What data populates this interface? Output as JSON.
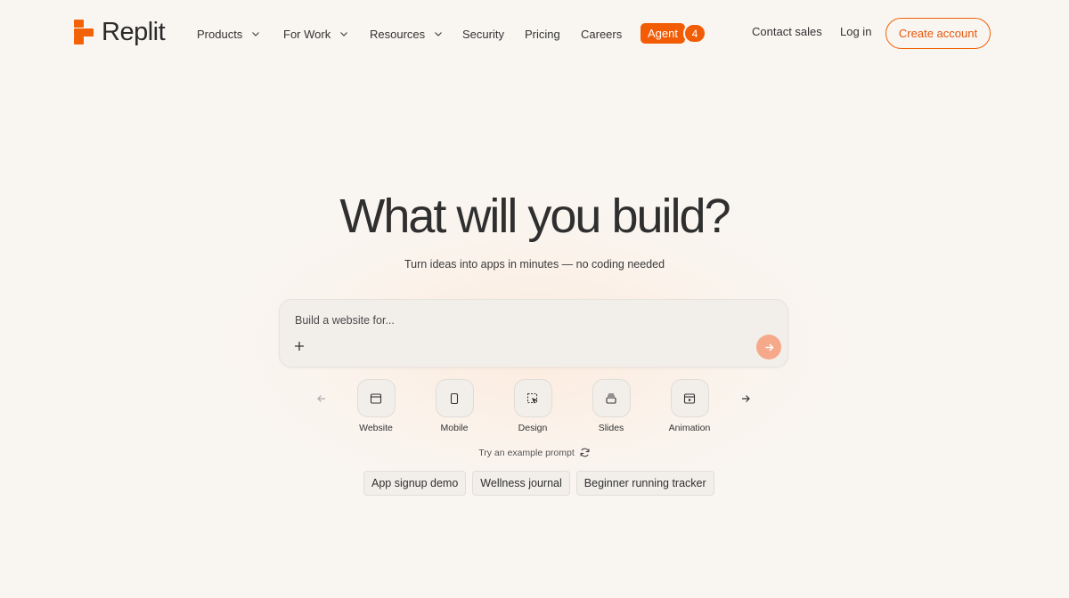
{
  "brand": {
    "name": "Replit",
    "accent": "#f26207"
  },
  "nav": {
    "items": [
      {
        "label": "Products",
        "has_dropdown": true
      },
      {
        "label": "For Work",
        "has_dropdown": true
      },
      {
        "label": "Resources",
        "has_dropdown": true
      },
      {
        "label": "Security",
        "has_dropdown": false
      },
      {
        "label": "Pricing",
        "has_dropdown": false
      },
      {
        "label": "Careers",
        "has_dropdown": false
      }
    ],
    "agent": {
      "label": "Agent",
      "badge": "4"
    },
    "contact_sales": "Contact sales",
    "log_in": "Log in",
    "create_account": "Create account"
  },
  "hero": {
    "title": "What will you build?",
    "subtitle": "Turn ideas into apps in minutes — no coding needed"
  },
  "prompt": {
    "placeholder": "Build a website for...",
    "value": "",
    "add_icon": "plus-icon",
    "send_icon": "arrow-right-icon"
  },
  "categories": [
    {
      "label": "Website",
      "icon": "browser-window-icon"
    },
    {
      "label": "Mobile",
      "icon": "phone-icon"
    },
    {
      "label": "Design",
      "icon": "design-cursor-icon"
    },
    {
      "label": "Slides",
      "icon": "slides-stack-icon"
    },
    {
      "label": "Animation",
      "icon": "animation-play-icon"
    }
  ],
  "examples": {
    "label": "Try an example prompt",
    "refresh_icon": "refresh-icon",
    "chips": [
      "App signup demo",
      "Wellness journal",
      "Beginner running tracker"
    ]
  }
}
